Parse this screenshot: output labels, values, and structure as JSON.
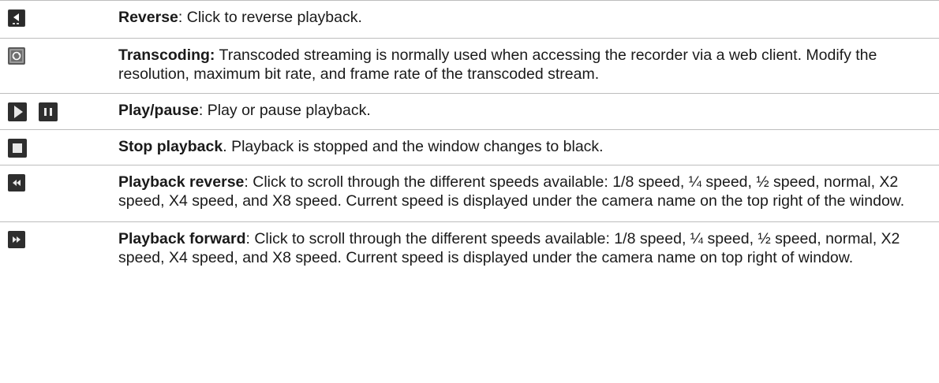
{
  "rows": [
    {
      "icons": [
        "reverse-icon"
      ],
      "title": "Reverse",
      "separator": ": ",
      "text": "Click to reverse playback."
    },
    {
      "icons": [
        "transcoding-icon"
      ],
      "title": "Transcoding:",
      "separator": " ",
      "text": "Transcoded streaming is normally used when accessing the recorder via a web client. Modify the resolution, maximum bit rate, and frame rate of the transcoded stream."
    },
    {
      "icons": [
        "play-icon",
        "pause-icon"
      ],
      "title": "Play/pause",
      "separator": ": ",
      "text": "Play or pause playback."
    },
    {
      "icons": [
        "stop-icon"
      ],
      "title": "Stop playback",
      "separator": ". ",
      "text": "Playback is stopped and the window changes to black."
    },
    {
      "icons": [
        "rewind-icon"
      ],
      "title": "Playback reverse",
      "separator": ": ",
      "text": "Click to scroll through the different speeds available: 1/8 speed, ¼ speed, ½ speed, normal, X2 speed, X4 speed, and X8 speed. Current speed is displayed under the camera name on the top right of the window."
    },
    {
      "icons": [
        "fast-forward-icon"
      ],
      "title": "Playback forward",
      "separator": ": ",
      "text": "Click to scroll through the different speeds available: 1/8 speed, ¼ speed, ½ speed, normal, X2 speed, X4 speed, and X8 speed. Current speed is displayed under the camera name on top right of window."
    }
  ],
  "colors": {
    "icon_bg_dark": "#2b2b2b",
    "icon_glyph": "#ffffff",
    "rule": "#bdbdbd",
    "text": "#1a1a1a"
  }
}
